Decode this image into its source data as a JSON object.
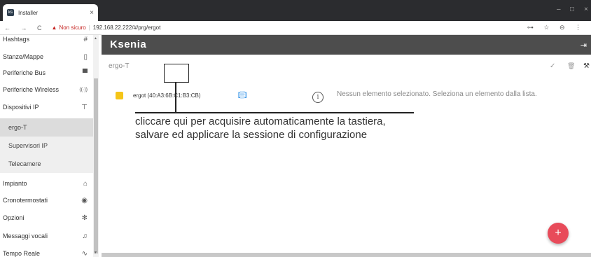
{
  "browser": {
    "tab_title": "Installer",
    "tab_close": "×",
    "favicon_text": "ks",
    "nav": "← → C",
    "warning": "▲",
    "not_secure": "Non sicuro",
    "separator": "|",
    "url": "192.168.22.222/#/prg/ergot",
    "right_icons": "⊶ ☆ ⊖ ⋮",
    "minimize": "–",
    "maximize": "□",
    "close": "×"
  },
  "sidebar": {
    "items": [
      {
        "label": "Hashtags",
        "icon": "#"
      },
      {
        "label": "Stanze/Mappe",
        "icon": "▯"
      },
      {
        "label": "Periferiche Bus",
        "icon": "▀"
      },
      {
        "label": "Periferiche Wireless",
        "icon": "((·))"
      },
      {
        "label": "Dispositivi IP",
        "icon": "⊤"
      }
    ],
    "subitems": [
      {
        "label": "ergo-T"
      },
      {
        "label": "Supervisori IP"
      },
      {
        "label": "Telecamere"
      }
    ],
    "items_after": [
      {
        "label": "Impianto",
        "icon": "⌂"
      },
      {
        "label": "Cronotermostati",
        "icon": "◉"
      },
      {
        "label": "Opzioni",
        "icon": "✻"
      },
      {
        "label": "Messaggi vocali",
        "icon": "♫"
      },
      {
        "label": "Tempo Reale",
        "icon": "∿"
      }
    ]
  },
  "appbar": {
    "logo_k": "Ks",
    "logo_rest": "enia",
    "logout_icon": "⇥"
  },
  "main": {
    "title": "ergo-T",
    "check": "✓",
    "trash": "🗑",
    "tools": "⚒",
    "device_label": "ergot (40:A3:6B:C1:B3:CB)",
    "scan_icon": "[▒]",
    "info_icon": "i",
    "info_text": "Nessun elemento selezionato. Seleziona un elemento dalla lista.",
    "fab": "+"
  },
  "callout": {
    "line1": "cliccare qui per acquisire automaticamente la tastiera,",
    "line2": "salvare ed applicare la sessione di configurazione"
  },
  "colors": {
    "accent": "#e84b5a",
    "appbar": "#4d4d4d",
    "device_icon": "#f5c518",
    "scan_icon": "#1e88e5"
  }
}
